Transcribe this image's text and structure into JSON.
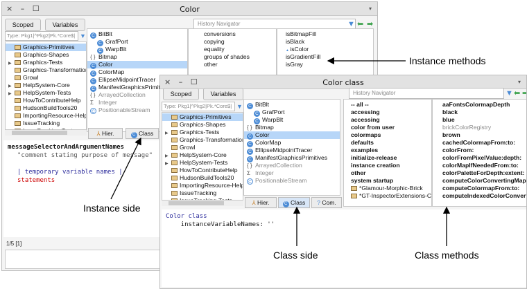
{
  "back": {
    "title": "Color",
    "nav": "History Navigator",
    "btn_scoped": "Scoped",
    "btn_vars": "Variables",
    "filter": "Type: Pkg1|^Pkg2|Pk.*Core$|",
    "packages": [
      "Graphics-Primitives",
      "Graphics-Shapes",
      "Graphics-Tests",
      "Graphics-Transformations",
      "Growl",
      "HelpSystem-Core",
      "HelpSystem-Tests",
      "HowToContributeHelp",
      "HudsonBuildTools20",
      "ImportingResource-Help",
      "IssueTracking",
      "IssueTracking-Tests"
    ],
    "classes": [
      "BitBlt",
      "GrafPort",
      "WarpBlt",
      "Bitmap",
      "Color",
      "ColorMap",
      "EllipseMidpointTracer",
      "ManifestGraphicsPrimitives",
      "ArrayedCollection",
      "Integer",
      "PositionableStream"
    ],
    "protocols": [
      "conversions",
      "copying",
      "equality",
      "groups of shades",
      "other"
    ],
    "methods": [
      "isBitmapFill",
      "isBlack",
      "isColor",
      "isGradientFill",
      "isGray"
    ],
    "tab_hier": "Hier.",
    "tab_class": "Class",
    "code": {
      "selector": "messageSelectorAndArgumentNames",
      "comment": "\"comment stating purpose of message\"",
      "temps": "| temporary variable names |",
      "stmts": "statements"
    },
    "status": "1/5 [1]"
  },
  "front": {
    "title": "Color class",
    "nav": "History Navigator",
    "btn_scoped": "Scoped",
    "btn_vars": "Variables",
    "filter": "Type: Pkg1|^Pkg2|Pk.*Core$|",
    "packages": [
      "Graphics-Primitives",
      "Graphics-Shapes",
      "Graphics-Tests",
      "Graphics-Transformations",
      "Growl",
      "HelpSystem-Core",
      "HelpSystem-Tests",
      "HowToContributeHelp",
      "HudsonBuildTools20",
      "ImportingResource-Help",
      "IssueTracking",
      "IssueTracking-Tests"
    ],
    "classes": [
      "BitBlt",
      "GrafPort",
      "WarpBlt",
      "Bitmap",
      "Color",
      "ColorMap",
      "EllipseMidpointTracer",
      "ManifestGraphicsPrimitives",
      "ArrayedCollection",
      "Integer",
      "PositionableStream"
    ],
    "protocols": [
      "-- all --",
      "accessing",
      "accessing",
      "color from user",
      "colormaps",
      "defaults",
      "examples",
      "initialize-release",
      "instance creation",
      "other",
      "system startup",
      "*Glamour-Morphic-Brick",
      "*GT-InspectorExtensions-C"
    ],
    "methods": [
      "aaFontsColormapDepth",
      "black",
      "blue",
      "brickColorRegistry",
      "brown",
      "cachedColormapFrom:to:",
      "colorFrom:",
      "colorFromPixelValue:depth:",
      "colorMapIfNeededFrom:to:",
      "colorPaletteForDepth:extent:",
      "computeColorConvertingMap:from:",
      "computeColormapFrom:to:",
      "computeIndexedColorConvertingMap:"
    ],
    "tab_hier": "Hier.",
    "tab_class": "Class",
    "tab_com": "Com.",
    "code": {
      "line1": "Color class",
      "line2": "    instanceVariableNames: ''"
    }
  },
  "annotations": {
    "instance_methods": "Instance methods",
    "instance_side": "Instance side",
    "class_side": "Class side",
    "class_methods": "Class methods"
  }
}
